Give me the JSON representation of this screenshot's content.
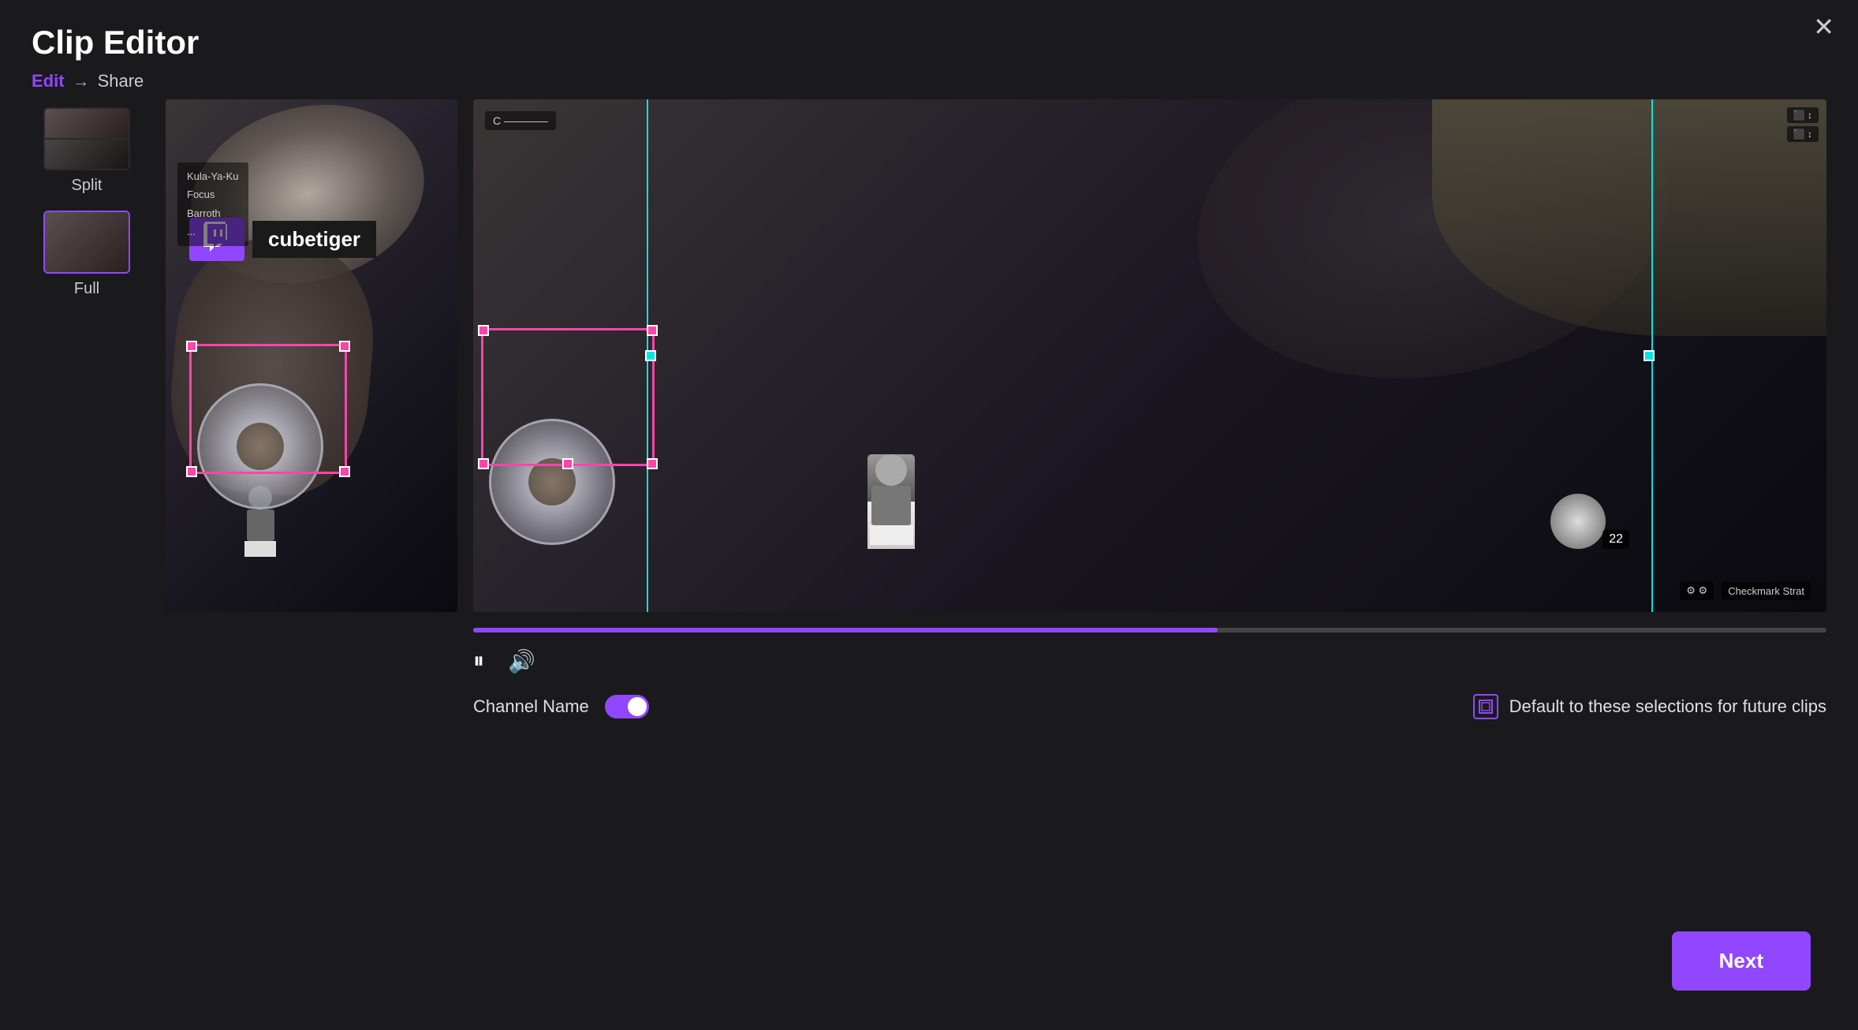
{
  "window": {
    "title": "Clip Editor"
  },
  "header": {
    "title": "Clip Editor",
    "breadcrumb": {
      "edit": "Edit",
      "arrow": "→",
      "share": "Share"
    }
  },
  "close_button_label": "✕",
  "layout_options": [
    {
      "id": "split",
      "label": "Split",
      "active": false
    },
    {
      "id": "full",
      "label": "Full",
      "active": true
    }
  ],
  "channel_overlay": {
    "channel_name": "cubetiger"
  },
  "controls": {
    "play_pause_icon": "⏸",
    "volume_icon": "🔊",
    "progress_percent": 55
  },
  "options": {
    "channel_name_label": "Channel Name",
    "toggle_on": true,
    "default_label": "Default to these selections for future clips"
  },
  "next_button": "Next"
}
